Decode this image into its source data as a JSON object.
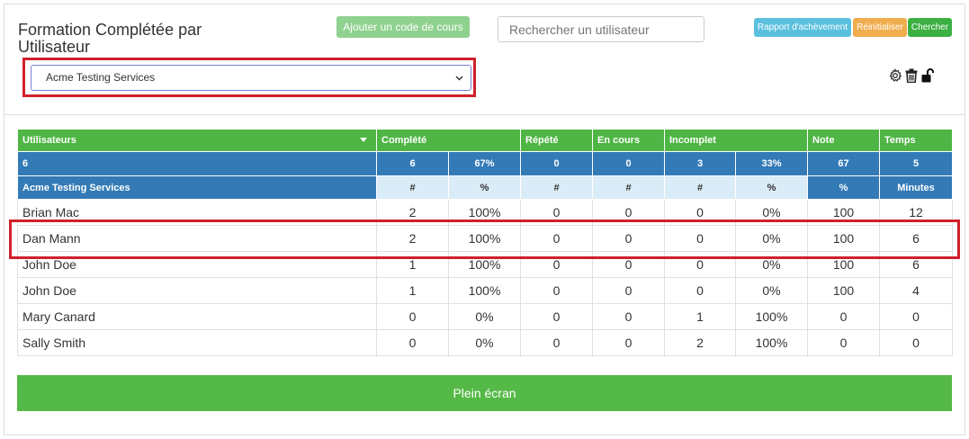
{
  "header": {
    "title": "Formation Complétée par Utilisateur",
    "add_course_label": "Ajouter un code de cours",
    "search_placeholder": "Rechercher un utilisateur",
    "report_label": "Rapport d'achèvement",
    "reset_label": "Réinitialiser",
    "search_label": "Chercher"
  },
  "organization_select": {
    "selected": "Acme Testing Services"
  },
  "icons": [
    "gear-icon",
    "trash-icon",
    "unlock-icon"
  ],
  "table": {
    "columns": {
      "users": "Utilisateurs",
      "completed": "Complété",
      "repeated": "Répété",
      "in_progress": "En cours",
      "incomplete": "Incomplet",
      "score": "Note",
      "time": "Temps"
    },
    "totals": [
      "6",
      "6",
      "67%",
      "0",
      "0",
      "3",
      "33%",
      "67",
      "5"
    ],
    "subheader": [
      "Acme Testing Services",
      "#",
      "%",
      "#",
      "#",
      "#",
      "%",
      "%",
      "Minutes"
    ],
    "rows": [
      [
        "Brian Mac",
        "2",
        "100%",
        "0",
        "0",
        "0",
        "0%",
        "100",
        "12"
      ],
      [
        "Dan Mann",
        "2",
        "100%",
        "0",
        "0",
        "0",
        "0%",
        "100",
        "6"
      ],
      [
        "John Doe",
        "1",
        "100%",
        "0",
        "0",
        "0",
        "0%",
        "100",
        "6"
      ],
      [
        "John Doe",
        "1",
        "100%",
        "0",
        "0",
        "0",
        "0%",
        "100",
        "4"
      ],
      [
        "Mary Canard",
        "0",
        "0%",
        "0",
        "0",
        "1",
        "100%",
        "0",
        "0"
      ],
      [
        "Sally Smith",
        "0",
        "0%",
        "0",
        "0",
        "2",
        "100%",
        "0",
        "0"
      ]
    ]
  },
  "fullscreen_label": "Plein écran",
  "colors": {
    "green": "#4fb544",
    "blue": "#337ab7",
    "light_blue": "#d9ecf7",
    "highlight": "#d0202a"
  }
}
